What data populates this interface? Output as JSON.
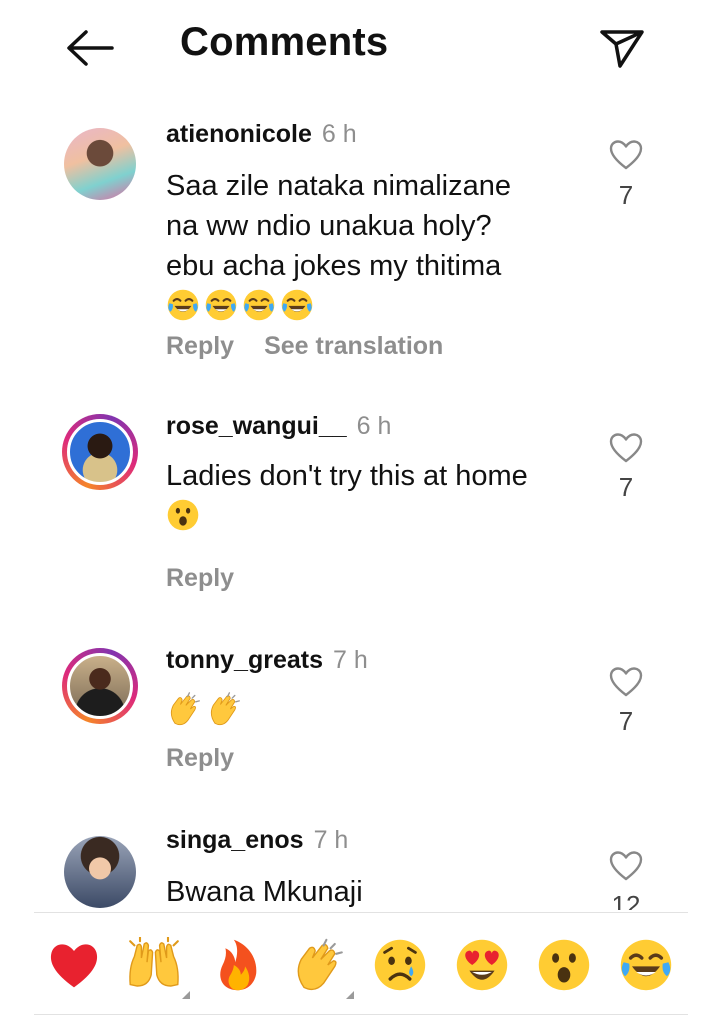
{
  "header": {
    "title": "Comments"
  },
  "comments": [
    {
      "username": "atienonicole",
      "time": "6 h",
      "lines": [
        "Saa zile nataka nimalizane",
        "na ww ndio unakua holy?",
        "ebu acha jokes my thitima"
      ],
      "emojis": [
        "face-with-tears-of-joy",
        "face-with-tears-of-joy",
        "face-with-tears-of-joy",
        "face-with-tears-of-joy"
      ],
      "reply_label": "Reply",
      "translate_label": "See translation",
      "likes": "7",
      "story_ring": false
    },
    {
      "username": "rose_wangui__",
      "time": "6 h",
      "lines": [
        "Ladies don't try this at home"
      ],
      "emojis": [
        "face-with-open-mouth"
      ],
      "reply_label": "Reply",
      "likes": "7",
      "story_ring": true
    },
    {
      "username": "tonny_greats",
      "time": "7 h",
      "lines": [],
      "emojis": [
        "clapping-hands",
        "clapping-hands"
      ],
      "reply_label": "Reply",
      "likes": "7",
      "story_ring": true
    },
    {
      "username": "singa_enos",
      "time": "7 h",
      "lines": [
        "Bwana Mkunaji"
      ],
      "emojis": [],
      "likes": "12",
      "story_ring": false
    }
  ],
  "emoji_bar": [
    "red-heart",
    "raising-hands",
    "fire",
    "clapping-hands",
    "crying-face",
    "heart-eyes",
    "face-with-open-mouth",
    "face-with-tears-of-joy"
  ],
  "colors": {
    "secondary_text": "#8e8e8e",
    "ring_start": "#f58529",
    "ring_end": "#dd2a7b"
  }
}
